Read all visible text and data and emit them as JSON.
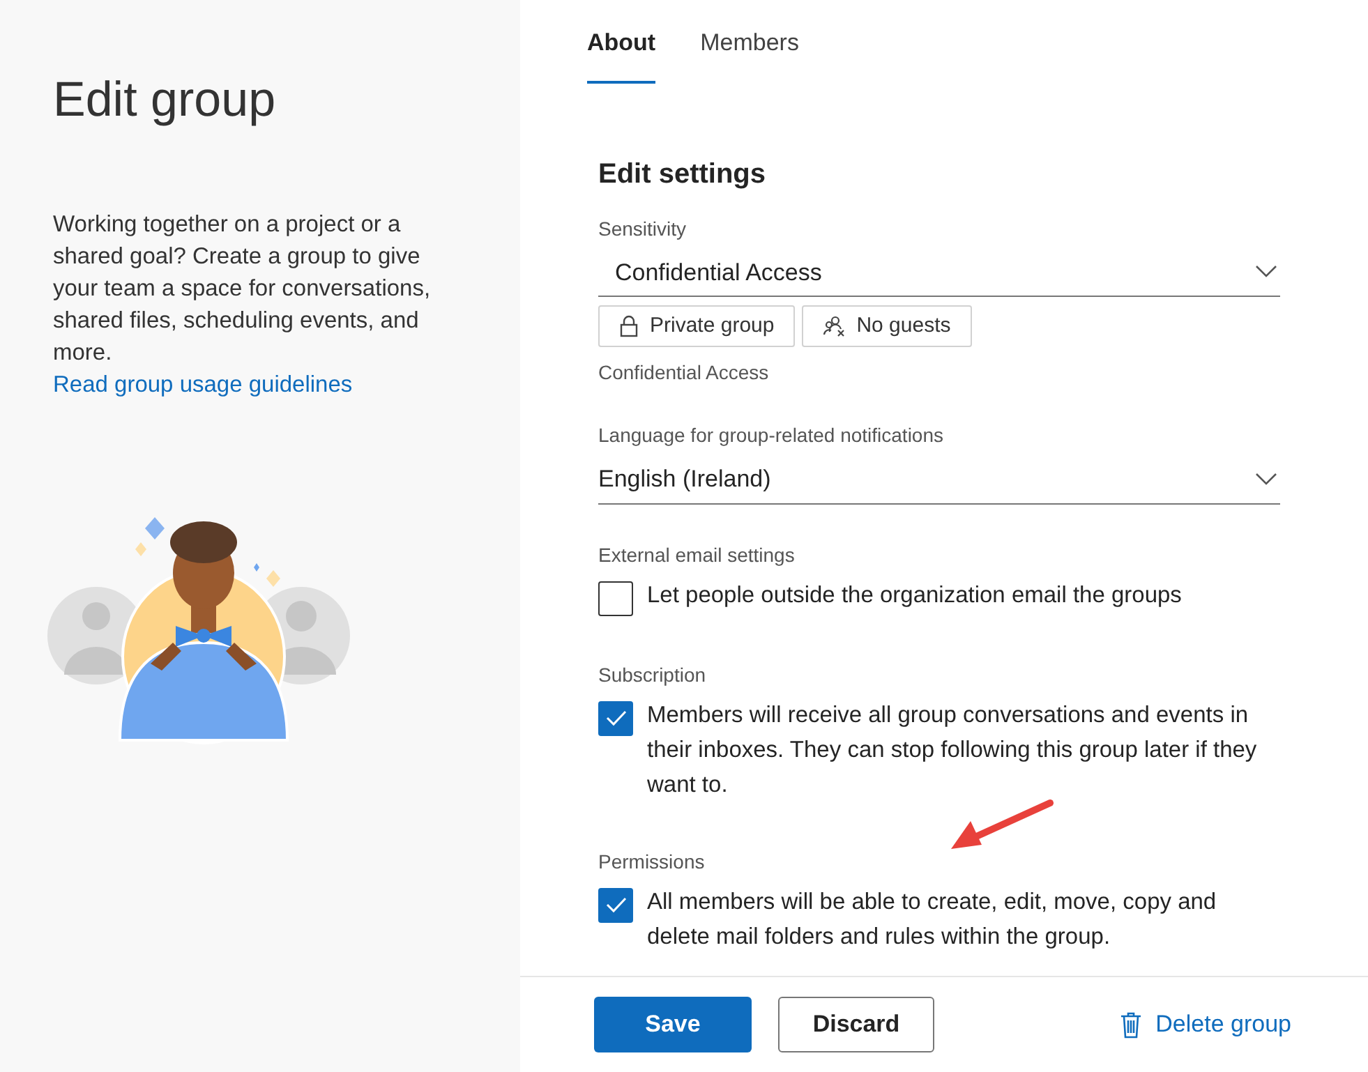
{
  "sidebar": {
    "title": "Edit group",
    "description": "Working together on a project or a shared goal? Create a group to give your team a space for conversations, shared files, scheduling events, and more.",
    "link": "Read group usage guidelines"
  },
  "tabs": [
    {
      "label": "About",
      "selected": true
    },
    {
      "label": "Members",
      "selected": false
    }
  ],
  "section_title": "Edit settings",
  "sensitivity": {
    "label": "Sensitivity",
    "value": "Confidential Access",
    "tags": [
      {
        "kind": "lock",
        "label": "Private group"
      },
      {
        "kind": "guests",
        "label": "No guests"
      }
    ],
    "note": "Confidential Access"
  },
  "language": {
    "label": "Language for group-related notifications",
    "value": "English (Ireland)"
  },
  "options": [
    {
      "heading": "External email settings",
      "text": "Let people outside the organization email the groups",
      "checked": false
    },
    {
      "heading": "Subscription",
      "text": "Members will receive all group conversations and events in their inboxes. They can stop following this group later if they want to.",
      "checked": true
    },
    {
      "heading": "Permissions",
      "text": "All members will be able to create, edit, move, copy and delete mail folders and rules within the group.",
      "checked": true
    }
  ],
  "buttons": {
    "save": "Save",
    "discard": "Discard",
    "delete": "Delete group"
  }
}
